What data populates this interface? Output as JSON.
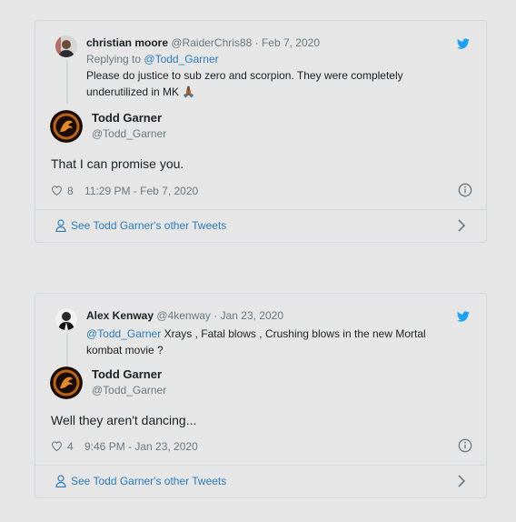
{
  "tweets": [
    {
      "reply": {
        "name": "christian moore",
        "handle": "@RaiderChris88",
        "date": "Feb 7, 2020",
        "replying_prefix": "Replying to",
        "replying_handle": "@Todd_Garner",
        "text": "Please do justice to sub zero and scorpion. They were completely underutilized in MK 🙏🏾",
        "avatar_icon": "profile-photo"
      },
      "author": {
        "name": "Todd Garner",
        "handle": "@Todd_Garner",
        "avatar_icon": "mortal-kombat-dragon-logo"
      },
      "text": "That I can promise you.",
      "likes": "8",
      "timestamp": "11:29 PM - Feb 7, 2020",
      "footer": "See Todd Garner's other Tweets"
    },
    {
      "reply": {
        "name": "Alex Kenway",
        "handle": "@4kenway",
        "date": "Jan 23, 2020",
        "mention": "@Todd_Garner",
        "text": " Xrays , Fatal blows , Crushing blows in the new Mortal kombat movie ?",
        "avatar_icon": "profile-photo"
      },
      "author": {
        "name": "Todd Garner",
        "handle": "@Todd_Garner",
        "avatar_icon": "mortal-kombat-dragon-logo"
      },
      "text": "Well they aren't dancing...",
      "likes": "4",
      "timestamp": "9:46 PM - Jan 23, 2020",
      "footer": "See Todd Garner's other Tweets"
    }
  ],
  "icons": {
    "brand": "twitter-bird-icon",
    "like": "heart-icon",
    "info": "info-icon",
    "profile": "person-icon",
    "more": "chevron-right-icon"
  },
  "colors": {
    "background": "#e6e6e6",
    "border": "#cfd9de",
    "link": "#2b7bb9",
    "twitter_blue": "#1da1f2",
    "muted": "#697882",
    "text": "#1c2022"
  }
}
